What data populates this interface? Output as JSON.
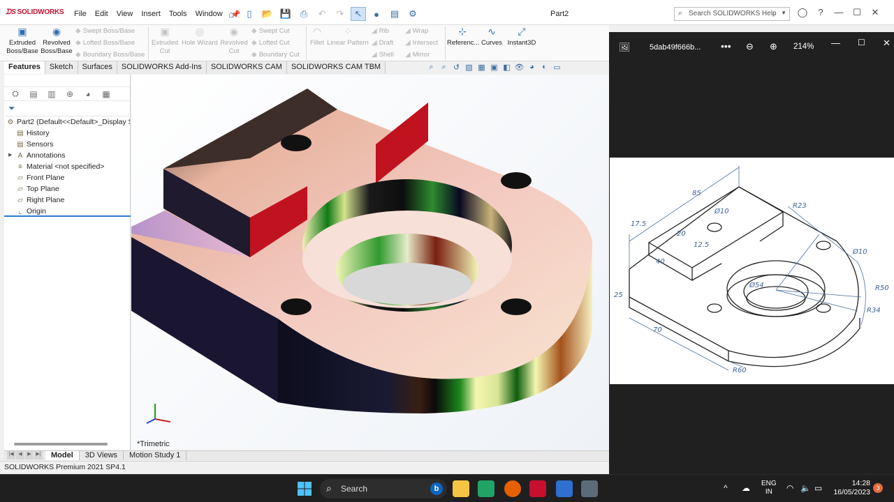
{
  "app": {
    "logo": "SOLIDWORKS",
    "doc_title": "Part2",
    "menu": [
      "File",
      "Edit",
      "View",
      "Insert",
      "Tools",
      "Window"
    ],
    "search_placeholder": "Search SOLIDWORKS Help"
  },
  "ribbon": {
    "extruded_boss": "Extruded Boss/Base",
    "revolved_boss": "Revolved Boss/Base",
    "swept_boss": "Swept Boss/Base",
    "lofted_boss": "Lofted Boss/Base",
    "boundary_boss": "Boundary Boss/Base",
    "extruded_cut": "Extruded Cut",
    "hole_wizard": "Hole Wizard",
    "revolved_cut": "Revolved Cut",
    "swept_cut": "Swept Cut",
    "lofted_cut": "Lofted Cut",
    "boundary_cut": "Boundary Cut",
    "fillet": "Fillet",
    "linear_pattern": "Linear Pattern",
    "rib": "Rib",
    "draft": "Draft",
    "shell": "Shell",
    "wrap": "Wrap",
    "intersect": "Intersect",
    "mirror": "Mirror",
    "reference": "Referenc...",
    "curves": "Curves",
    "instant3d": "Instant3D"
  },
  "tabs": [
    "Features",
    "Sketch",
    "Surfaces",
    "SOLIDWORKS Add-Ins",
    "SOLIDWORKS CAM",
    "SOLIDWORKS CAM TBM"
  ],
  "tree": {
    "root": "Part2  (Default<<Default>_Display S",
    "items": [
      "History",
      "Sensors",
      "Annotations",
      "Material <not specified>",
      "Front Plane",
      "Top Plane",
      "Right Plane",
      "Origin"
    ]
  },
  "viewport": {
    "view_label": "*Trimetric"
  },
  "bottom_tabs": [
    "Model",
    "3D Views",
    "Motion Study 1"
  ],
  "status": "SOLIDWORKS Premium 2021 SP4.1",
  "viewer": {
    "file_name": "5dab49f666b...",
    "zoom": "214%"
  },
  "drawing": {
    "dims": [
      "85",
      "17.5",
      "Ø10",
      "R23",
      "20",
      "12.5",
      "40",
      "Ø10",
      "R50",
      "R34",
      "70",
      "R60",
      "25",
      "Ø54"
    ]
  },
  "taskbar": {
    "search": "Search",
    "lang_line1": "ENG",
    "lang_line2": "IN",
    "time": "14:28",
    "date": "16/05/2023",
    "notif_count": "3"
  },
  "colors": {
    "sw_red": "#c8102e",
    "selection_blue": "#2b7bd0",
    "viewer_bg": "#202020",
    "taskbar_bg": "#1f1f1f"
  }
}
